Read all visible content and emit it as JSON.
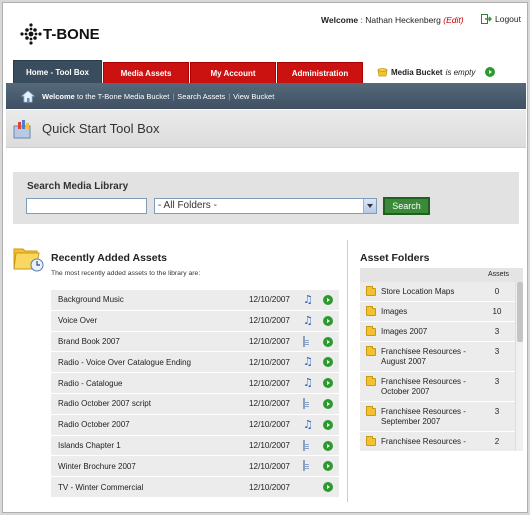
{
  "header": {
    "logo_text": "T-BONE",
    "welcome_label": "Welcome",
    "user_name": "Nathan Heckenberg",
    "edit_label": "(Edit)",
    "logout_label": "Logout"
  },
  "nav": {
    "tabs": [
      {
        "label": "Home - Tool Box",
        "active": true
      },
      {
        "label": "Media Assets",
        "active": false
      },
      {
        "label": "My Account",
        "active": false
      },
      {
        "label": "Administration",
        "active": false
      }
    ],
    "bucket_label": "Media Bucket",
    "bucket_status": "is empty"
  },
  "subnav": {
    "welcome_bold": "Welcome",
    "welcome_rest": "to the T-Bone Media Bucket",
    "search_assets": "Search Assets",
    "view_bucket": "View Bucket"
  },
  "page_title": "Quick Start Tool Box",
  "search": {
    "label": "Search Media Library",
    "query": "",
    "folder_selected": "- All Folders -",
    "button_label": "Search"
  },
  "recent": {
    "title": "Recently Added Assets",
    "subtitle": "The most recently added assets to the library are:",
    "items": [
      {
        "name": "Background Music",
        "date": "12/10/2007",
        "type": "audio"
      },
      {
        "name": "Voice Over",
        "date": "12/10/2007",
        "type": "audio"
      },
      {
        "name": "Brand Book 2007",
        "date": "12/10/2007",
        "type": "document"
      },
      {
        "name": "Radio - Voice Over Catalogue Ending",
        "date": "12/10/2007",
        "type": "audio"
      },
      {
        "name": "Radio - Catalogue",
        "date": "12/10/2007",
        "type": "audio"
      },
      {
        "name": "Radio October 2007 script",
        "date": "12/10/2007",
        "type": "document"
      },
      {
        "name": "Radio October 2007",
        "date": "12/10/2007",
        "type": "audio"
      },
      {
        "name": "Islands Chapter 1",
        "date": "12/10/2007",
        "type": "document"
      },
      {
        "name": "Winter Brochure 2007",
        "date": "12/10/2007",
        "type": "document"
      },
      {
        "name": "TV - Winter Commercial",
        "date": "12/10/2007",
        "type": "video"
      }
    ]
  },
  "folders": {
    "title": "Asset Folders",
    "count_header": "Assets",
    "items": [
      {
        "name": "Store Location Maps",
        "count": "0"
      },
      {
        "name": "Images",
        "count": "10"
      },
      {
        "name": "Images 2007",
        "count": "3"
      },
      {
        "name": "Franchisee Resources - August 2007",
        "count": "3"
      },
      {
        "name": "Franchisee Resources - October 2007",
        "count": "3"
      },
      {
        "name": "Franchisee Resources - September 2007",
        "count": "3"
      },
      {
        "name": "Franchisee Resources -",
        "count": "2"
      }
    ]
  },
  "colors": {
    "tab_red": "#cc1111",
    "tab_active": "#3a4d5e",
    "go_green": "#2d9a2d",
    "edit_red": "#cc0000"
  }
}
